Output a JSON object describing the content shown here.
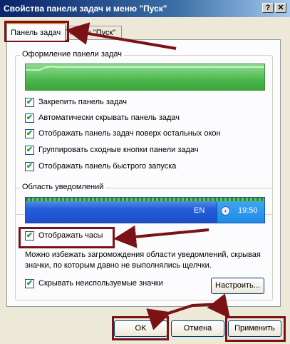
{
  "window": {
    "title": "Свойства панели задач и меню \"Пуск\"",
    "help_label": "?",
    "close_label": "✕"
  },
  "tabs": [
    {
      "label": "Панель задач",
      "active": true
    },
    {
      "label": "Меню \"Пуск\"",
      "active": false
    }
  ],
  "taskbar_group": {
    "legend": "Оформление панели задач",
    "options": [
      {
        "label": "Закрепить панель задач",
        "checked": true
      },
      {
        "label": "Автоматически скрывать панель задач",
        "checked": true
      },
      {
        "label": "Отображать панель задач поверх остальных окон",
        "checked": true
      },
      {
        "label": "Группировать сходные кнопки панели задач",
        "checked": true
      },
      {
        "label": "Отображать панель быстрого запуска",
        "checked": true
      }
    ]
  },
  "notify_group": {
    "legend": "Область уведомлений",
    "lang": "EN",
    "clock": "19:50",
    "show_clock": {
      "label": "Отображать часы",
      "checked": true
    },
    "description": "Можно избежать загромождения области уведомлений, скрывая значки, по которым давно не выполнялись щелчки.",
    "hide_icons": {
      "label": "Скрывать неиспользуемые значки",
      "checked": true
    },
    "customize_label": "Настроить..."
  },
  "buttons": {
    "ok": "OK",
    "cancel": "Отмена",
    "apply": "Применить"
  },
  "colors": {
    "annotation": "#7a1216",
    "preview_green": "#5cc05c",
    "taskbar_blue": "#245edb"
  }
}
